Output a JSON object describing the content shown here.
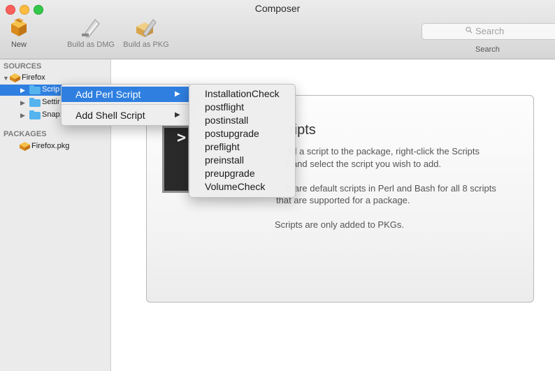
{
  "window": {
    "title": "Composer"
  },
  "toolbar": {
    "new_label": "New",
    "build_dmg_label": "Build as DMG",
    "build_pkg_label": "Build as PKG",
    "search_placeholder": "Search",
    "search_label": "Search"
  },
  "sidebar": {
    "sources_header": "SOURCES",
    "source_name": "Firefox",
    "items": [
      {
        "label": "Scrip",
        "selected": true
      },
      {
        "label": "Settir",
        "selected": false
      },
      {
        "label": "Snap:",
        "selected": false
      }
    ],
    "packages_header": "PACKAGES",
    "packages": [
      {
        "label": "Firefox.pkg"
      }
    ]
  },
  "panel": {
    "title": "ripts",
    "line1": "dd a script to the package, right-click the Scripts",
    "line2": "r and select the script you wish to add.",
    "line3": "e are default scripts in Perl and Bash for all 8 scripts",
    "line4": "that are supported for a package.",
    "line5": "Scripts are only added to PKGs.",
    "terminal_prompt": ">"
  },
  "context_menu": {
    "items": [
      {
        "label": "Add Perl Script",
        "highlighted": true
      },
      {
        "label": "Add Shell Script",
        "highlighted": false
      }
    ],
    "submenu": [
      "InstallationCheck",
      "postflight",
      "postinstall",
      "postupgrade",
      "preflight",
      "preinstall",
      "preupgrade",
      "VolumeCheck"
    ]
  },
  "colors": {
    "accent": "#2f7fe0",
    "folder": "#55b4ee"
  }
}
